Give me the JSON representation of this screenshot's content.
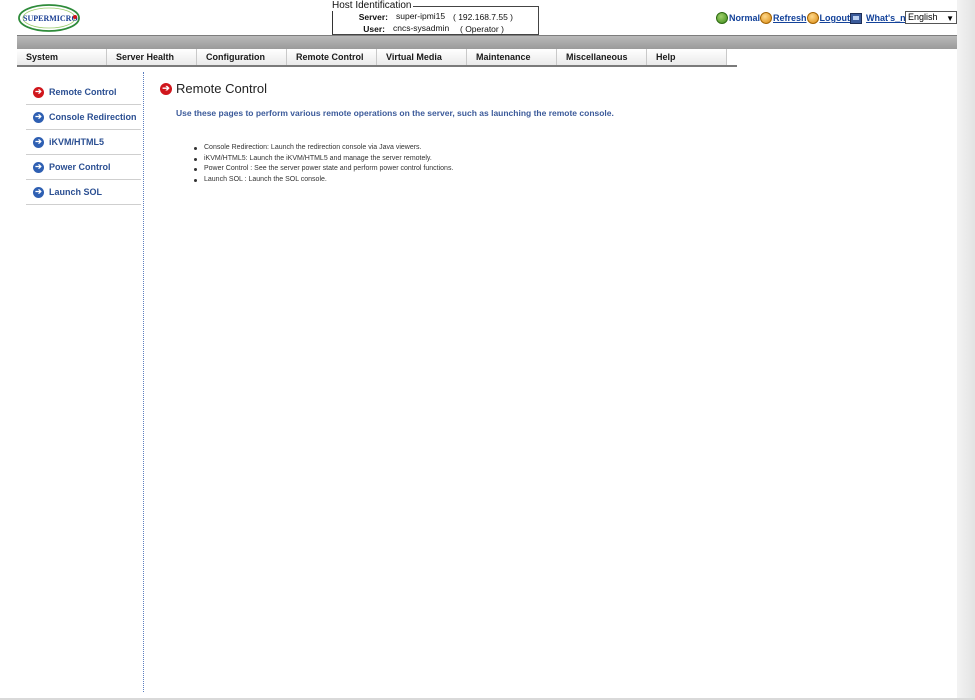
{
  "header": {
    "logo_text": "SUPERMICRO",
    "host_title": "Host Identification",
    "server_label": "Server:",
    "server_value": "super-ipmi15",
    "server_ip": "( 192.168.7.55 )",
    "user_label": "User:",
    "user_value": "cncs-sysadmin",
    "user_role": "( Operator )",
    "status": {
      "normal": "Normal",
      "refresh": "Refresh",
      "logout": "Logout",
      "whats_new": "What's_new"
    },
    "language": "English"
  },
  "nav": {
    "items": [
      "System",
      "Server Health",
      "Configuration",
      "Remote Control",
      "Virtual Media",
      "Maintenance",
      "Miscellaneous",
      "Help"
    ]
  },
  "sidebar": {
    "items": [
      {
        "label": "Remote Control",
        "icon": "arrow-right-circle-red"
      },
      {
        "label": "Console Redirection",
        "icon": "arrow-right-circle-blue"
      },
      {
        "label": "iKVM/HTML5",
        "icon": "arrow-right-circle-blue"
      },
      {
        "label": "Power Control",
        "icon": "arrow-right-circle-blue"
      },
      {
        "label": "Launch SOL",
        "icon": "arrow-right-circle-blue"
      }
    ]
  },
  "main": {
    "title": "Remote Control",
    "description": "Use these pages to perform various remote operations on the server, such as launching the remote console.",
    "bullets": [
      "Console Redirection: Launch the redirection console via Java viewers.",
      "iKVM/HTML5: Launch the iKVM/HTML5 and manage the server remotely.",
      "Power Control : See the server power state and perform power control functions.",
      "Launch SOL : Launch the SOL console."
    ]
  },
  "colors": {
    "accent_blue": "#2b4f92",
    "accent_red": "#d0161c",
    "nav_gray": "#9a9a9a"
  }
}
